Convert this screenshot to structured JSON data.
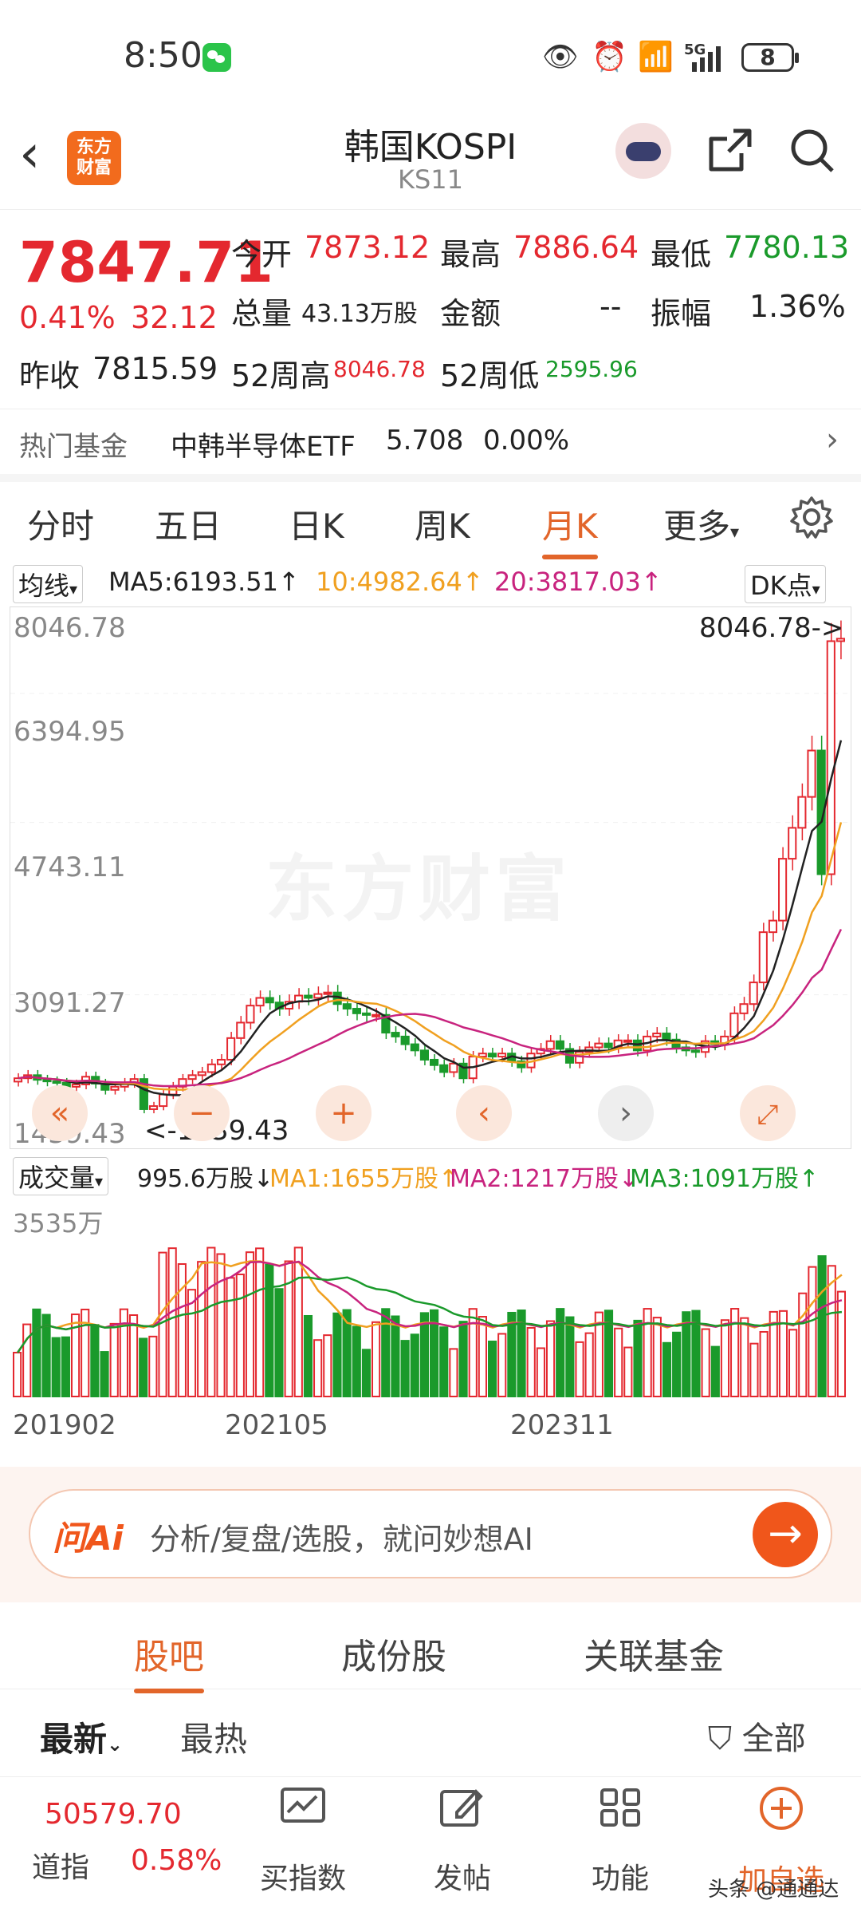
{
  "status": {
    "time": "8:50",
    "battery": "8",
    "signal_label": "5G"
  },
  "header": {
    "title": "韩国KOSPI",
    "code": "KS11",
    "logo_text": "东方\n财富"
  },
  "quote": {
    "price": "7847.71",
    "change_pct": "0.41%",
    "change": "32.12",
    "open_label": "今开",
    "open": "7873.12",
    "high_label": "最高",
    "high": "7886.64",
    "low_label": "最低",
    "low": "7780.13",
    "volume_label": "总量",
    "volume": "43.13万股",
    "amount_label": "金额",
    "amount": "--",
    "amp_label": "振幅",
    "amp": "1.36%",
    "prev_label": "昨收",
    "prev": "7815.59",
    "w52h_label": "52周高",
    "w52h": "8046.78",
    "w52l_label": "52周低",
    "w52l": "2595.96"
  },
  "fund": {
    "label": "热门基金",
    "name": "中韩半导体ETF",
    "price": "5.708",
    "pct": "0.00%"
  },
  "ktabs": [
    "分时",
    "五日",
    "日K",
    "周K",
    "月K",
    "更多"
  ],
  "ma": {
    "type": "均线",
    "ma5": "MA5:6193.51↑",
    "ma10": "10:4982.64↑",
    "ma20": "20:3817.03↑",
    "dk": "DK点"
  },
  "chart": {
    "y_labels": [
      "8046.78",
      "6394.95",
      "4743.11",
      "3091.27",
      "1439.43"
    ],
    "max_label": "8046.78->",
    "min_label": "<-1439.43",
    "watermark": "东方财富"
  },
  "vol_line": {
    "type": "成交量",
    "v": "995.6万股↓",
    "ma1": "MA1:1655万股↑",
    "ma2": "MA2:1217万股↓",
    "ma3": "MA3:1091万股↑",
    "max_label": "3535万"
  },
  "x_labels": [
    "201902",
    "202105",
    "202311"
  ],
  "colors": {
    "up": "#e4282f",
    "down": "#1a9a2b",
    "accent": "#e2652a",
    "ma10": "#f0a020",
    "ma20": "#c8237e"
  },
  "ai": {
    "brand": "问Ai",
    "placeholder": "分析/复盘/选股，就问妙想AI"
  },
  "bottom_tabs": [
    "股吧",
    "成份股",
    "关联基金"
  ],
  "filter": {
    "latest": "最新",
    "hot": "最热",
    "all": "全部"
  },
  "nav": {
    "index_value": "50579.70",
    "index_name": "道指",
    "index_pct": "0.58%",
    "items": [
      "买指数",
      "发帖",
      "功能",
      "加自选"
    ],
    "watermark": "头条 @通通达"
  },
  "chart_data": {
    "type": "candlestick",
    "y_range": [
      1439.43,
      8046.78
    ],
    "x_ticks": [
      "201902",
      "202105",
      "202311"
    ],
    "candles_close_approx": [
      2160,
      2200,
      2140,
      2120,
      2100,
      2050,
      2080,
      2180,
      2090,
      2010,
      2050,
      2100,
      2150,
      1760,
      1800,
      1950,
      2050,
      2150,
      2200,
      2240,
      2340,
      2400,
      2680,
      2880,
      3100,
      3200,
      3140,
      3060,
      3150,
      3230,
      3200,
      3250,
      3270,
      3120,
      3060,
      3000,
      2980,
      2980,
      2750,
      2700,
      2600,
      2520,
      2400,
      2330,
      2240,
      2350,
      2160,
      2440,
      2480,
      2440,
      2480,
      2380,
      2300,
      2480,
      2540,
      2640,
      2540,
      2360,
      2500,
      2560,
      2610,
      2560,
      2650,
      2650,
      2520,
      2700,
      2740,
      2660,
      2560,
      2520,
      2500,
      2640,
      2600,
      2700,
      3000,
      3120,
      3400,
      4050,
      4200,
      5000,
      5400,
      5800,
      6400,
      4800,
      7815,
      7847
    ],
    "ma5": "6193.51",
    "ma10": "4982.64",
    "ma20": "3817.03",
    "volume_max": "3535万",
    "volume_last": "995.6万股"
  }
}
